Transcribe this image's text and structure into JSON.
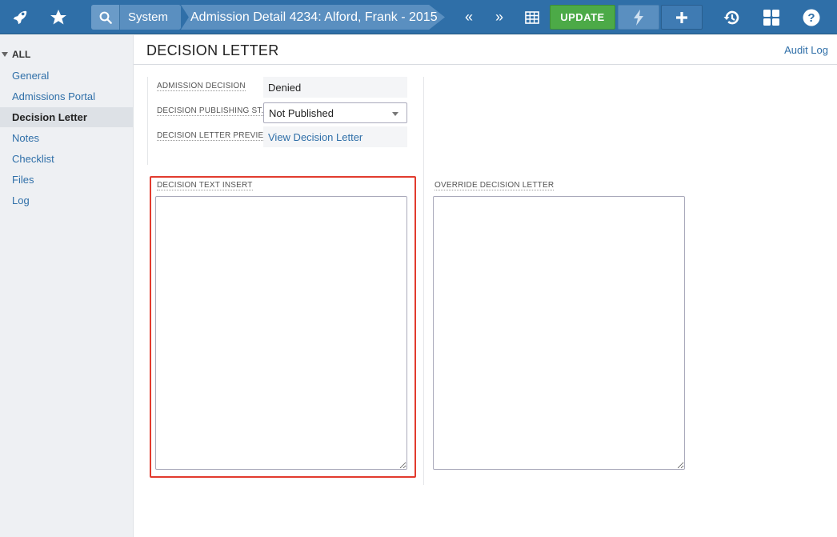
{
  "topbar": {
    "rocket_icon": "rocket-icon",
    "star_icon": "star-icon",
    "search_icon": "search-icon",
    "search_scope": "System",
    "breadcrumb": "Admission Detail 4234: Alford, Frank - 2015",
    "prev_label": "«",
    "next_label": "»",
    "grid_icon": "table-icon",
    "update_label": "UPDATE",
    "bolt_icon": "lightning-icon",
    "plus_icon": "plus-icon",
    "history_icon": "history-icon",
    "apps_icon": "apps-grid-icon",
    "help_icon": "help-icon",
    "colors": {
      "bar": "#2f6fa8",
      "update": "#4caa47"
    }
  },
  "sidebar": {
    "root_label": "ALL",
    "items": [
      {
        "label": "General",
        "active": false
      },
      {
        "label": "Admissions Portal",
        "active": false
      },
      {
        "label": "Decision Letter",
        "active": true
      },
      {
        "label": "Notes",
        "active": false
      },
      {
        "label": "Checklist",
        "active": false
      },
      {
        "label": "Files",
        "active": false
      },
      {
        "label": "Log",
        "active": false
      }
    ]
  },
  "main": {
    "title": "DECISION LETTER",
    "audit_log": "Audit Log",
    "fields": {
      "admission_decision": {
        "label": "ADMISSION DECISION",
        "value": "Denied"
      },
      "publishing_status": {
        "label": "DECISION PUBLISHING ST...",
        "value": "Not Published"
      },
      "letter_preview": {
        "label": "DECISION LETTER PREVIEW",
        "value": "View Decision Letter"
      }
    },
    "decision_text_insert": {
      "label": "DECISION TEXT INSERT",
      "value": ""
    },
    "override_letter": {
      "label": "OVERRIDE DECISION LETTER",
      "value": ""
    },
    "highlight_color": "#e23b2e"
  }
}
